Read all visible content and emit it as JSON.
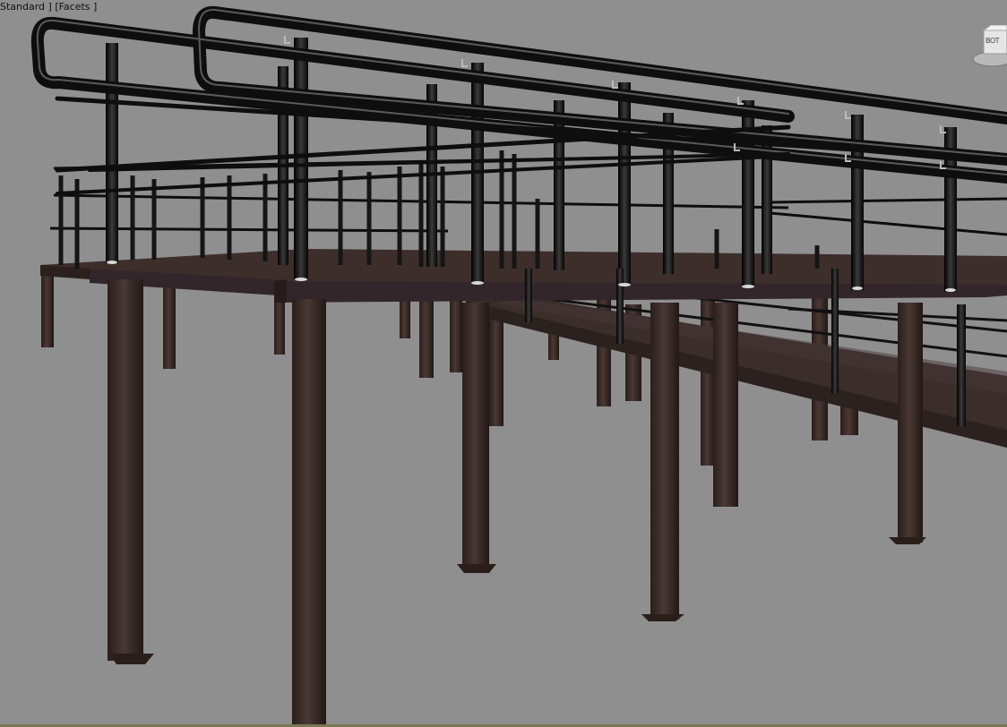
{
  "viewport": {
    "label": "Standard ] [Facets ]",
    "background": "#8f8f8f"
  },
  "viewcube": {
    "label": "BOT",
    "icon": "viewcube-icon"
  },
  "model": {
    "description_icon": "ramp-structure",
    "frame_color": "#3a2b27",
    "deck_color": "#2f2623",
    "rail_color": "#151515"
  }
}
